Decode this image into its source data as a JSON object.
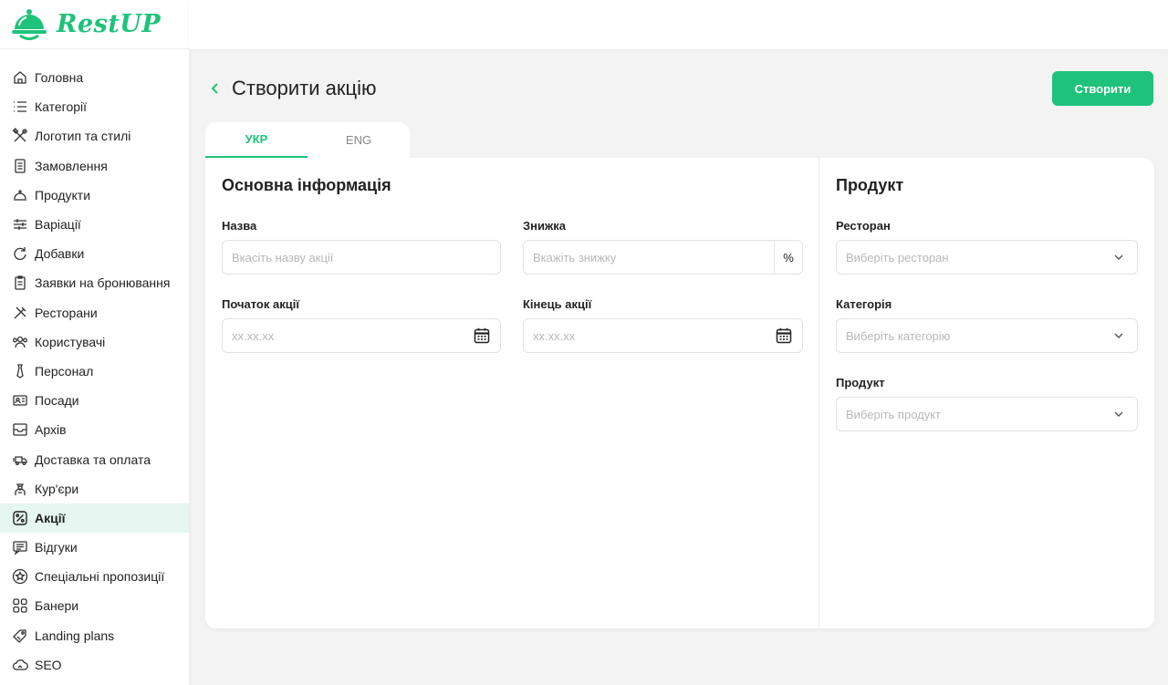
{
  "app": {
    "logo_text": "RestUP"
  },
  "sidebar": {
    "items": [
      {
        "label": "Головна",
        "icon": "home-icon"
      },
      {
        "label": "Категорії",
        "icon": "list-icon"
      },
      {
        "label": "Логотип та стилі",
        "icon": "tools-icon"
      },
      {
        "label": "Замовлення",
        "icon": "receipt-icon"
      },
      {
        "label": "Продукти",
        "icon": "cloche-icon"
      },
      {
        "label": "Варіації",
        "icon": "sliders-icon"
      },
      {
        "label": "Добавки",
        "icon": "refresh-icon"
      },
      {
        "label": "Заявки на бронювання",
        "icon": "clipboard-icon"
      },
      {
        "label": "Ресторани",
        "icon": "utensils-icon"
      },
      {
        "label": "Користувачі",
        "icon": "users-icon"
      },
      {
        "label": "Персонал",
        "icon": "tie-icon"
      },
      {
        "label": "Посади",
        "icon": "id-card-icon"
      },
      {
        "label": "Архів",
        "icon": "archive-icon"
      },
      {
        "label": "Доставка та оплата",
        "icon": "delivery-icon"
      },
      {
        "label": "Кур'єри",
        "icon": "courier-icon"
      },
      {
        "label": "Акції",
        "icon": "percent-icon",
        "active": true
      },
      {
        "label": "Відгуки",
        "icon": "comments-icon"
      },
      {
        "label": "Спеціальні пропозиції",
        "icon": "star-icon"
      },
      {
        "label": "Банери",
        "icon": "grid-icon"
      },
      {
        "label": "Landing plans",
        "icon": "tag-icon"
      },
      {
        "label": "SEO",
        "icon": "cloud-icon"
      }
    ]
  },
  "header": {
    "title": "Створити акцію",
    "create_label": "Створити"
  },
  "tabs": [
    {
      "label": "УКР",
      "active": true
    },
    {
      "label": "ENG",
      "active": false
    }
  ],
  "main_info": {
    "title": "Основна інформація",
    "name": {
      "label": "Назва",
      "placeholder": "Вкасіть назву акції",
      "value": ""
    },
    "discount": {
      "label": "Знижка",
      "placeholder": "Вкажіть знижку",
      "suffix": "%",
      "value": ""
    },
    "start": {
      "label": "Початок акції",
      "placeholder": "xx.xx.xx",
      "value": ""
    },
    "end": {
      "label": "Кінець акції",
      "placeholder": "xx.xx.xx",
      "value": ""
    }
  },
  "product": {
    "title": "Продукт",
    "restaurant": {
      "label": "Ресторан",
      "placeholder": "Виберіть ресторан"
    },
    "category": {
      "label": "Категорія",
      "placeholder": "Виберіть категорію"
    },
    "product": {
      "label": "Продукт",
      "placeholder": "Виберіть продукт"
    }
  },
  "colors": {
    "accent": "#1fc27a",
    "active_bg": "#e6f6f1"
  }
}
